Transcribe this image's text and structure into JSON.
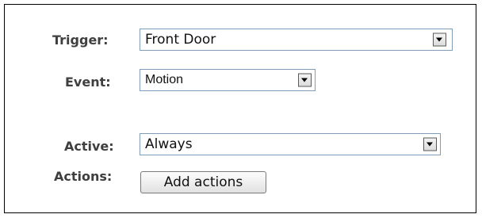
{
  "form": {
    "trigger": {
      "label": "Trigger:",
      "value": "Front Door"
    },
    "event": {
      "label": "Event:",
      "value": "Motion"
    },
    "active": {
      "label": "Active:",
      "value": "Always"
    },
    "actions": {
      "label": "Actions:",
      "button_label": "Add actions"
    }
  },
  "icons": {
    "dropdown": "chevron-down-icon"
  },
  "colors": {
    "label_text": "#3f3f3f",
    "field_border": "#7f9db9",
    "panel_border": "#000000"
  }
}
